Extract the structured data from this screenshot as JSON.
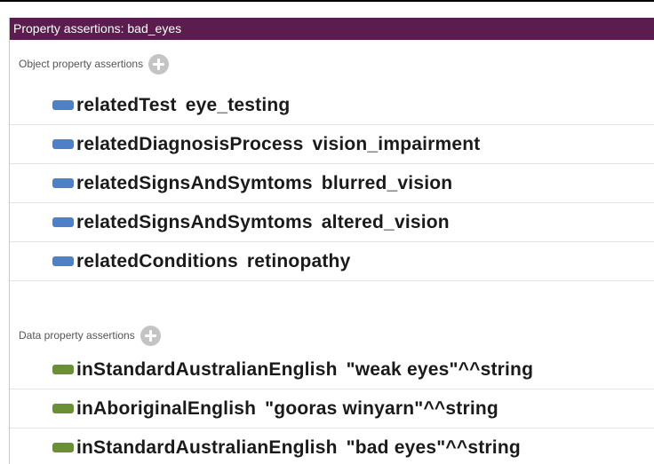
{
  "title": "Property assertions: bad_eyes",
  "object_section": {
    "label": "Object property assertions",
    "rows": [
      {
        "property": "relatedTest",
        "value": "eye_testing"
      },
      {
        "property": "relatedDiagnosisProcess",
        "value": "vision_impairment"
      },
      {
        "property": "relatedSignsAndSymtoms",
        "value": "blurred_vision"
      },
      {
        "property": "relatedSignsAndSymtoms",
        "value": "altered_vision"
      },
      {
        "property": "relatedConditions",
        "value": "retinopathy"
      }
    ]
  },
  "data_section": {
    "label": "Data property assertions",
    "rows": [
      {
        "property": "inStandardAustralianEnglish",
        "value": "\"weak eyes\"^^string"
      },
      {
        "property": "inAboriginalEnglish",
        "value": "\"gooras winyarn\"^^string"
      },
      {
        "property": "inStandardAustralianEnglish",
        "value": "\"bad eyes\"^^string"
      }
    ]
  },
  "colors": {
    "titlebar": "#5a1d4e",
    "object_property_icon": "#4f7fc6",
    "data_property_icon": "#6b8f34"
  },
  "icons": {
    "add": "add-circle-icon",
    "object_property": "object-property-icon",
    "data_property": "data-property-icon"
  }
}
